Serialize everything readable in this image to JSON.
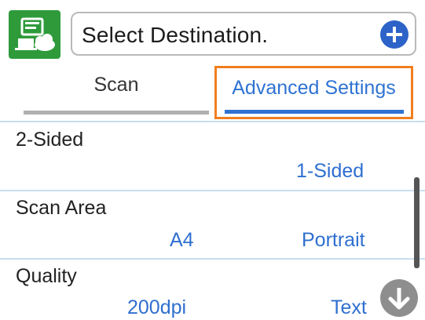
{
  "header": {
    "app_icon": "scan-to-computer-icon",
    "destination_placeholder": "Select Destination.",
    "add_icon": "plus-icon"
  },
  "tabs": [
    {
      "label": "Scan",
      "selected": false
    },
    {
      "label": "Advanced Settings",
      "selected": true
    }
  ],
  "settings": [
    {
      "label": "2-Sided",
      "values": [
        "1-Sided"
      ]
    },
    {
      "label": "Scan Area",
      "values": [
        "A4",
        "Portrait"
      ]
    },
    {
      "label": "Quality",
      "values": [
        "200dpi",
        "Text"
      ]
    }
  ],
  "scroll": {
    "down_icon": "arrow-down-icon"
  },
  "colors": {
    "accent_blue": "#2f73d2",
    "focus_orange": "#f07f1e",
    "icon_green": "#2e9a3a",
    "add_blue": "#2d63c8"
  }
}
